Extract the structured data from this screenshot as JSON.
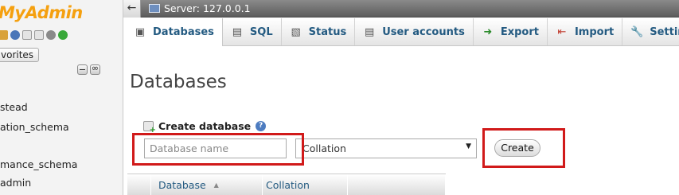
{
  "sidebar": {
    "logo_text": "MyAdmin",
    "favorites_label": "vorites",
    "databases": [
      "stead",
      "ation_schema",
      "mance_schema",
      "admin"
    ]
  },
  "topbar": {
    "back_label": "←",
    "server_label": "Server: 127.0.0.1"
  },
  "tabs": [
    {
      "label": "Databases",
      "icon": "database-icon"
    },
    {
      "label": "SQL",
      "icon": "sql-icon"
    },
    {
      "label": "Status",
      "icon": "status-icon"
    },
    {
      "label": "User accounts",
      "icon": "user-accounts-icon"
    },
    {
      "label": "Export",
      "icon": "export-icon"
    },
    {
      "label": "Import",
      "icon": "import-icon"
    },
    {
      "label": "Settings",
      "icon": "settings-icon"
    }
  ],
  "main": {
    "title": "Databases",
    "create_heading": "Create database",
    "db_name_placeholder": "Database name",
    "collation_value": "Collation",
    "create_button": "Create"
  },
  "table": {
    "columns": [
      "Database",
      "Collation"
    ]
  },
  "colors": {
    "highlight": "#d11a1a",
    "link": "#235a81",
    "logo": "#f5a00f"
  }
}
